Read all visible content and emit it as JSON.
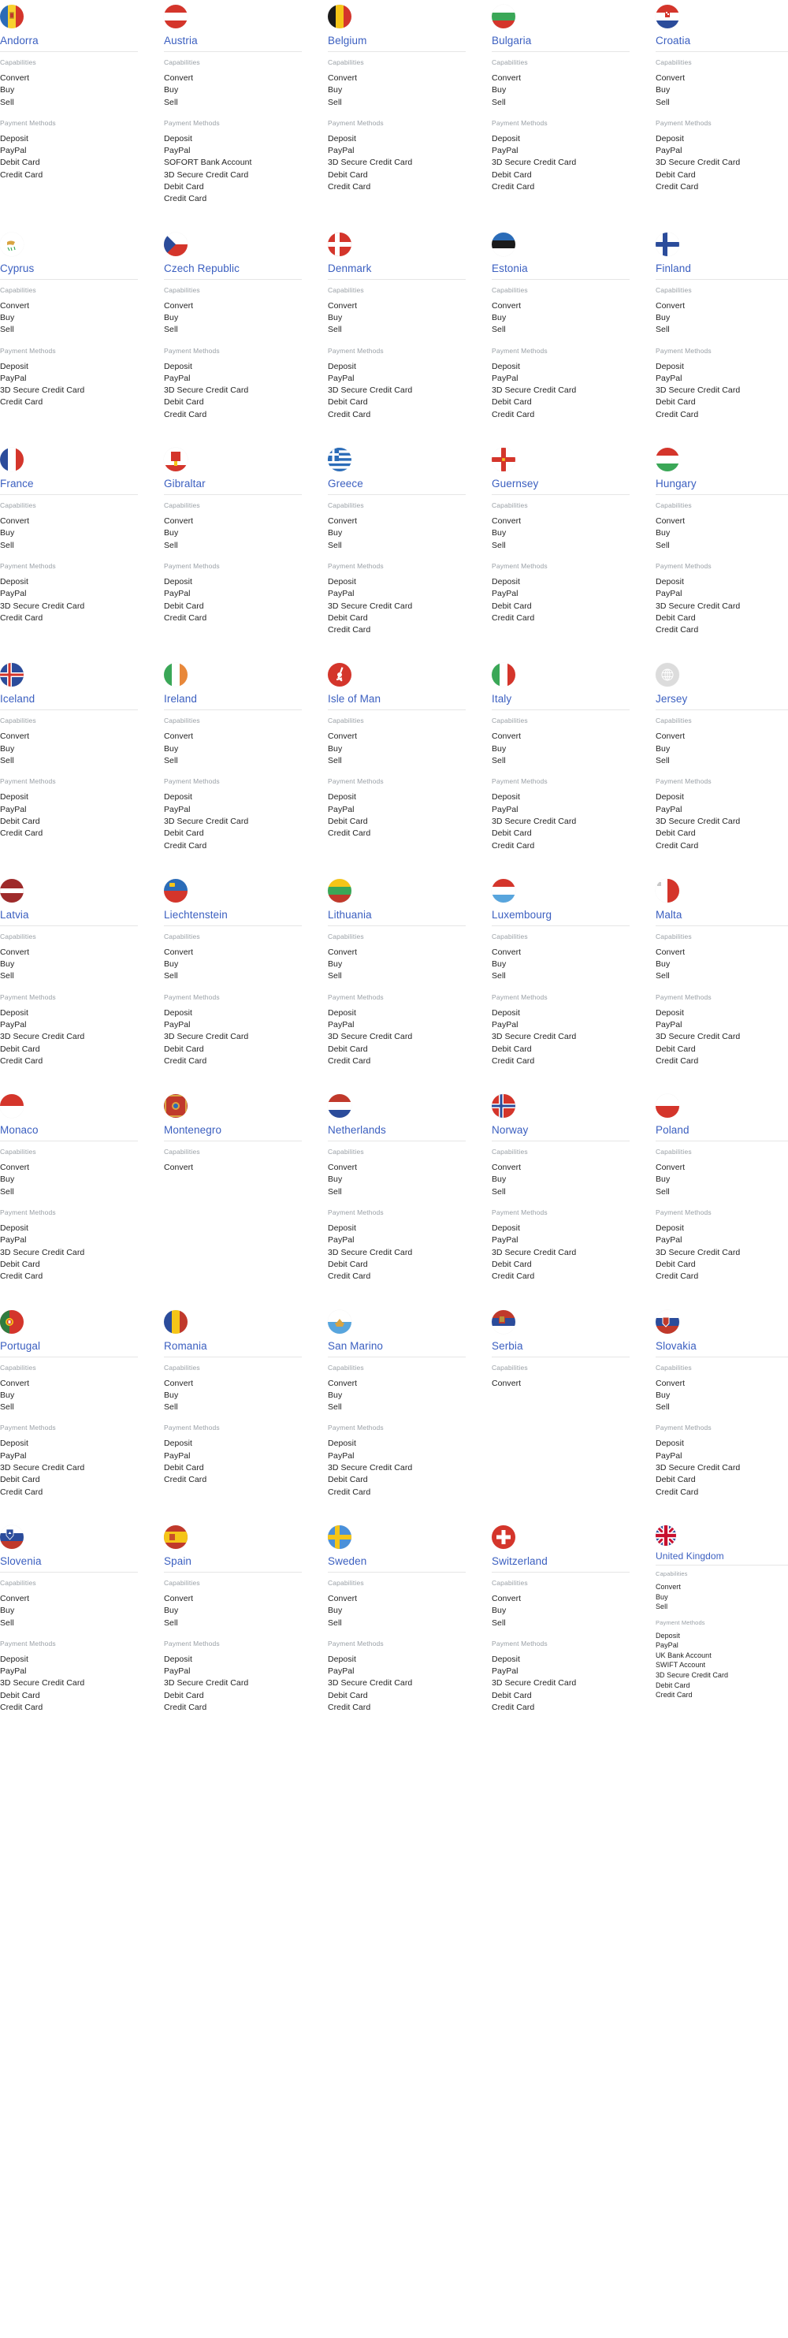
{
  "labels": {
    "capabilities": "Capabilities",
    "payment_methods": "Payment Methods"
  },
  "colors": {
    "link": "#3b5fc0",
    "section_header": "#9aa0a6",
    "item_text": "#242424",
    "rule": "#e6e6e6",
    "background": "#ffffff"
  },
  "grid": {
    "columns": 5,
    "rows": 8
  },
  "countries": [
    {
      "name": "Andorra",
      "flag_icon": "flag-andorra-icon",
      "compact": false,
      "capabilities": [
        "Convert",
        "Buy",
        "Sell"
      ],
      "payment_methods": [
        "Deposit",
        "PayPal",
        "Debit Card",
        "Credit Card"
      ]
    },
    {
      "name": "Austria",
      "flag_icon": "flag-austria-icon",
      "compact": false,
      "capabilities": [
        "Convert",
        "Buy",
        "Sell"
      ],
      "payment_methods": [
        "Deposit",
        "PayPal",
        "SOFORT Bank Account",
        "3D Secure Credit Card",
        "Debit Card",
        "Credit Card"
      ]
    },
    {
      "name": "Belgium",
      "flag_icon": "flag-belgium-icon",
      "compact": false,
      "capabilities": [
        "Convert",
        "Buy",
        "Sell"
      ],
      "payment_methods": [
        "Deposit",
        "PayPal",
        "3D Secure Credit Card",
        "Debit Card",
        "Credit Card"
      ]
    },
    {
      "name": "Bulgaria",
      "flag_icon": "flag-bulgaria-icon",
      "compact": false,
      "capabilities": [
        "Convert",
        "Buy",
        "Sell"
      ],
      "payment_methods": [
        "Deposit",
        "PayPal",
        "3D Secure Credit Card",
        "Debit Card",
        "Credit Card"
      ]
    },
    {
      "name": "Croatia",
      "flag_icon": "flag-croatia-icon",
      "compact": false,
      "capabilities": [
        "Convert",
        "Buy",
        "Sell"
      ],
      "payment_methods": [
        "Deposit",
        "PayPal",
        "3D Secure Credit Card",
        "Debit Card",
        "Credit Card"
      ]
    },
    {
      "name": "Cyprus",
      "flag_icon": "flag-cyprus-icon",
      "compact": false,
      "capabilities": [
        "Convert",
        "Buy",
        "Sell"
      ],
      "payment_methods": [
        "Deposit",
        "PayPal",
        "3D Secure Credit Card",
        "Credit Card"
      ]
    },
    {
      "name": "Czech Republic",
      "flag_icon": "flag-czech-republic-icon",
      "compact": false,
      "capabilities": [
        "Convert",
        "Buy",
        "Sell"
      ],
      "payment_methods": [
        "Deposit",
        "PayPal",
        "3D Secure Credit Card",
        "Debit Card",
        "Credit Card"
      ]
    },
    {
      "name": "Denmark",
      "flag_icon": "flag-denmark-icon",
      "compact": false,
      "capabilities": [
        "Convert",
        "Buy",
        "Sell"
      ],
      "payment_methods": [
        "Deposit",
        "PayPal",
        "3D Secure Credit Card",
        "Debit Card",
        "Credit Card"
      ]
    },
    {
      "name": "Estonia",
      "flag_icon": "flag-estonia-icon",
      "compact": false,
      "capabilities": [
        "Convert",
        "Buy",
        "Sell"
      ],
      "payment_methods": [
        "Deposit",
        "PayPal",
        "3D Secure Credit Card",
        "Debit Card",
        "Credit Card"
      ]
    },
    {
      "name": "Finland",
      "flag_icon": "flag-finland-icon",
      "compact": false,
      "capabilities": [
        "Convert",
        "Buy",
        "Sell"
      ],
      "payment_methods": [
        "Deposit",
        "PayPal",
        "3D Secure Credit Card",
        "Debit Card",
        "Credit Card"
      ]
    },
    {
      "name": "France",
      "flag_icon": "flag-france-icon",
      "compact": false,
      "capabilities": [
        "Convert",
        "Buy",
        "Sell"
      ],
      "payment_methods": [
        "Deposit",
        "PayPal",
        "3D Secure Credit Card",
        "Credit Card"
      ]
    },
    {
      "name": "Gibraltar",
      "flag_icon": "flag-gibraltar-icon",
      "compact": false,
      "capabilities": [
        "Convert",
        "Buy",
        "Sell"
      ],
      "payment_methods": [
        "Deposit",
        "PayPal",
        "Debit Card",
        "Credit Card"
      ]
    },
    {
      "name": "Greece",
      "flag_icon": "flag-greece-icon",
      "compact": false,
      "capabilities": [
        "Convert",
        "Buy",
        "Sell"
      ],
      "payment_methods": [
        "Deposit",
        "PayPal",
        "3D Secure Credit Card",
        "Debit Card",
        "Credit Card"
      ]
    },
    {
      "name": "Guernsey",
      "flag_icon": "flag-guernsey-icon",
      "compact": false,
      "capabilities": [
        "Convert",
        "Buy",
        "Sell"
      ],
      "payment_methods": [
        "Deposit",
        "PayPal",
        "Debit Card",
        "Credit Card"
      ]
    },
    {
      "name": "Hungary",
      "flag_icon": "flag-hungary-icon",
      "compact": false,
      "capabilities": [
        "Convert",
        "Buy",
        "Sell"
      ],
      "payment_methods": [
        "Deposit",
        "PayPal",
        "3D Secure Credit Card",
        "Debit Card",
        "Credit Card"
      ]
    },
    {
      "name": "Iceland",
      "flag_icon": "flag-iceland-icon",
      "compact": false,
      "capabilities": [
        "Convert",
        "Buy",
        "Sell"
      ],
      "payment_methods": [
        "Deposit",
        "PayPal",
        "Debit Card",
        "Credit Card"
      ]
    },
    {
      "name": "Ireland",
      "flag_icon": "flag-ireland-icon",
      "compact": false,
      "capabilities": [
        "Convert",
        "Buy",
        "Sell"
      ],
      "payment_methods": [
        "Deposit",
        "PayPal",
        "3D Secure Credit Card",
        "Debit Card",
        "Credit Card"
      ]
    },
    {
      "name": "Isle of Man",
      "flag_icon": "flag-isle-of-man-icon",
      "compact": false,
      "capabilities": [
        "Convert",
        "Buy",
        "Sell"
      ],
      "payment_methods": [
        "Deposit",
        "PayPal",
        "Debit Card",
        "Credit Card"
      ]
    },
    {
      "name": "Italy",
      "flag_icon": "flag-italy-icon",
      "compact": false,
      "capabilities": [
        "Convert",
        "Buy",
        "Sell"
      ],
      "payment_methods": [
        "Deposit",
        "PayPal",
        "3D Secure Credit Card",
        "Debit Card",
        "Credit Card"
      ]
    },
    {
      "name": "Jersey",
      "flag_icon": "globe-placeholder-icon",
      "compact": false,
      "capabilities": [
        "Convert",
        "Buy",
        "Sell"
      ],
      "payment_methods": [
        "Deposit",
        "PayPal",
        "3D Secure Credit Card",
        "Debit Card",
        "Credit Card"
      ]
    },
    {
      "name": "Latvia",
      "flag_icon": "flag-latvia-icon",
      "compact": false,
      "capabilities": [
        "Convert",
        "Buy",
        "Sell"
      ],
      "payment_methods": [
        "Deposit",
        "PayPal",
        "3D Secure Credit Card",
        "Debit Card",
        "Credit Card"
      ]
    },
    {
      "name": "Liechtenstein",
      "flag_icon": "flag-liechtenstein-icon",
      "compact": false,
      "capabilities": [
        "Convert",
        "Buy",
        "Sell"
      ],
      "payment_methods": [
        "Deposit",
        "PayPal",
        "3D Secure Credit Card",
        "Debit Card",
        "Credit Card"
      ]
    },
    {
      "name": "Lithuania",
      "flag_icon": "flag-lithuania-icon",
      "compact": false,
      "capabilities": [
        "Convert",
        "Buy",
        "Sell"
      ],
      "payment_methods": [
        "Deposit",
        "PayPal",
        "3D Secure Credit Card",
        "Debit Card",
        "Credit Card"
      ]
    },
    {
      "name": "Luxembourg",
      "flag_icon": "flag-luxembourg-icon",
      "compact": false,
      "capabilities": [
        "Convert",
        "Buy",
        "Sell"
      ],
      "payment_methods": [
        "Deposit",
        "PayPal",
        "3D Secure Credit Card",
        "Debit Card",
        "Credit Card"
      ]
    },
    {
      "name": "Malta",
      "flag_icon": "flag-malta-icon",
      "compact": false,
      "capabilities": [
        "Convert",
        "Buy",
        "Sell"
      ],
      "payment_methods": [
        "Deposit",
        "PayPal",
        "3D Secure Credit Card",
        "Debit Card",
        "Credit Card"
      ]
    },
    {
      "name": "Monaco",
      "flag_icon": "flag-monaco-icon",
      "compact": false,
      "capabilities": [
        "Convert",
        "Buy",
        "Sell"
      ],
      "payment_methods": [
        "Deposit",
        "PayPal",
        "3D Secure Credit Card",
        "Debit Card",
        "Credit Card"
      ]
    },
    {
      "name": "Montenegro",
      "flag_icon": "flag-montenegro-icon",
      "compact": false,
      "capabilities": [
        "Convert"
      ],
      "payment_methods": []
    },
    {
      "name": "Netherlands",
      "flag_icon": "flag-netherlands-icon",
      "compact": false,
      "capabilities": [
        "Convert",
        "Buy",
        "Sell"
      ],
      "payment_methods": [
        "Deposit",
        "PayPal",
        "3D Secure Credit Card",
        "Debit Card",
        "Credit Card"
      ]
    },
    {
      "name": "Norway",
      "flag_icon": "flag-norway-icon",
      "compact": false,
      "capabilities": [
        "Convert",
        "Buy",
        "Sell"
      ],
      "payment_methods": [
        "Deposit",
        "PayPal",
        "3D Secure Credit Card",
        "Debit Card",
        "Credit Card"
      ]
    },
    {
      "name": "Poland",
      "flag_icon": "flag-poland-icon",
      "compact": false,
      "capabilities": [
        "Convert",
        "Buy",
        "Sell"
      ],
      "payment_methods": [
        "Deposit",
        "PayPal",
        "3D Secure Credit Card",
        "Debit Card",
        "Credit Card"
      ]
    },
    {
      "name": "Portugal",
      "flag_icon": "flag-portugal-icon",
      "compact": false,
      "capabilities": [
        "Convert",
        "Buy",
        "Sell"
      ],
      "payment_methods": [
        "Deposit",
        "PayPal",
        "3D Secure Credit Card",
        "Debit Card",
        "Credit Card"
      ]
    },
    {
      "name": "Romania",
      "flag_icon": "flag-romania-icon",
      "compact": false,
      "capabilities": [
        "Convert",
        "Buy",
        "Sell"
      ],
      "payment_methods": [
        "Deposit",
        "PayPal",
        "Debit Card",
        "Credit Card"
      ]
    },
    {
      "name": "San Marino",
      "flag_icon": "flag-san-marino-icon",
      "compact": false,
      "capabilities": [
        "Convert",
        "Buy",
        "Sell"
      ],
      "payment_methods": [
        "Deposit",
        "PayPal",
        "3D Secure Credit Card",
        "Debit Card",
        "Credit Card"
      ]
    },
    {
      "name": "Serbia",
      "flag_icon": "flag-serbia-icon",
      "compact": false,
      "capabilities": [
        "Convert"
      ],
      "payment_methods": []
    },
    {
      "name": "Slovakia",
      "flag_icon": "flag-slovakia-icon",
      "compact": false,
      "capabilities": [
        "Convert",
        "Buy",
        "Sell"
      ],
      "payment_methods": [
        "Deposit",
        "PayPal",
        "3D Secure Credit Card",
        "Debit Card",
        "Credit Card"
      ]
    },
    {
      "name": "Slovenia",
      "flag_icon": "flag-slovenia-icon",
      "compact": false,
      "capabilities": [
        "Convert",
        "Buy",
        "Sell"
      ],
      "payment_methods": [
        "Deposit",
        "PayPal",
        "3D Secure Credit Card",
        "Debit Card",
        "Credit Card"
      ]
    },
    {
      "name": "Spain",
      "flag_icon": "flag-spain-icon",
      "compact": false,
      "capabilities": [
        "Convert",
        "Buy",
        "Sell"
      ],
      "payment_methods": [
        "Deposit",
        "PayPal",
        "3D Secure Credit Card",
        "Debit Card",
        "Credit Card"
      ]
    },
    {
      "name": "Sweden",
      "flag_icon": "flag-sweden-icon",
      "compact": false,
      "capabilities": [
        "Convert",
        "Buy",
        "Sell"
      ],
      "payment_methods": [
        "Deposit",
        "PayPal",
        "3D Secure Credit Card",
        "Debit Card",
        "Credit Card"
      ]
    },
    {
      "name": "Switzerland",
      "flag_icon": "flag-switzerland-icon",
      "compact": false,
      "capabilities": [
        "Convert",
        "Buy",
        "Sell"
      ],
      "payment_methods": [
        "Deposit",
        "PayPal",
        "3D Secure Credit Card",
        "Debit Card",
        "Credit Card"
      ]
    },
    {
      "name": "United Kingdom",
      "flag_icon": "flag-united-kingdom-icon",
      "compact": true,
      "capabilities": [
        "Convert",
        "Buy",
        "Sell"
      ],
      "payment_methods": [
        "Deposit",
        "PayPal",
        "UK Bank Account",
        "SWIFT Account",
        "3D Secure Credit Card",
        "Debit Card",
        "Credit Card"
      ]
    }
  ]
}
